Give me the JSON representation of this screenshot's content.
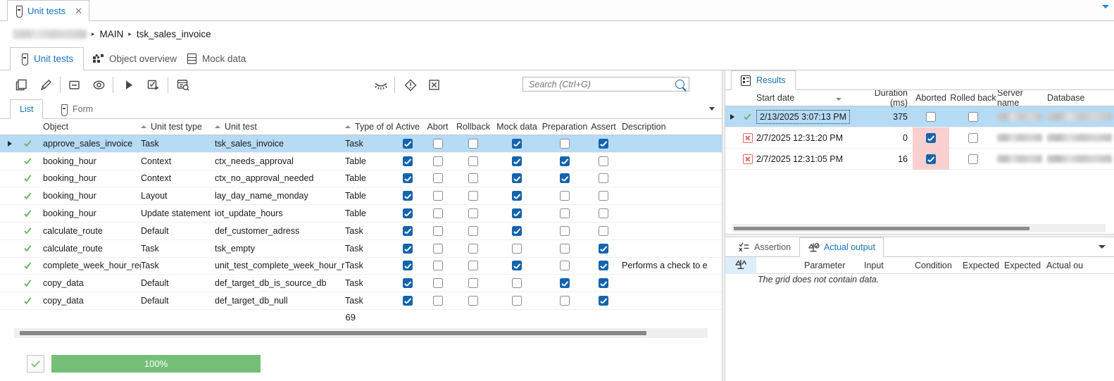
{
  "window": {
    "document_tab": {
      "label": "Unit tests",
      "close": "✕",
      "icon": "test-tube-icon"
    },
    "collapse_chevron": "▾"
  },
  "breadcrumb": {
    "redacted": "",
    "sep": "▸",
    "items": [
      "MAIN",
      "tsk_sales_invoice"
    ]
  },
  "module_tabs": [
    {
      "label": "Unit tests",
      "icon": "test-tube-icon",
      "active": true
    },
    {
      "label": "Object overview",
      "icon": "object-overview-icon",
      "active": false
    },
    {
      "label": "Mock data",
      "icon": "mock-data-icon",
      "active": false
    }
  ],
  "toolbar": {
    "buttons": [
      {
        "name": "copy-button",
        "icon": "copy-icon"
      },
      {
        "name": "edit-button",
        "icon": "pencil-icon"
      },
      {
        "name": "delete-button",
        "icon": "minus-box-icon"
      },
      {
        "name": "view-button",
        "icon": "eye-icon"
      },
      {
        "name": "run-button",
        "icon": "play-icon"
      },
      {
        "name": "run-selected-button",
        "icon": "run-checked-icon"
      },
      {
        "name": "inspect-button",
        "icon": "inspect-grid-icon"
      },
      {
        "name": "hide-button",
        "icon": "eye-closed-icon"
      },
      {
        "name": "warnings-button",
        "icon": "warning-diamond-icon"
      },
      {
        "name": "stop-button",
        "icon": "cancel-box-icon"
      }
    ],
    "search": {
      "placeholder": "Search (Ctrl+G)",
      "value": "",
      "icon": "search-icon"
    }
  },
  "view_tabs": [
    {
      "label": "List",
      "active": true
    },
    {
      "label": "Form",
      "icon": "test-tube-icon",
      "active": false
    }
  ],
  "grid": {
    "columns": [
      {
        "key": "object",
        "label": "Object",
        "sorted": true
      },
      {
        "key": "unit_test_type",
        "label": "Unit test type",
        "sorted": true
      },
      {
        "key": "unit_test",
        "label": "Unit test",
        "sorted": true
      },
      {
        "key": "type_of_object",
        "label": "Type of object",
        "sorted": true
      },
      {
        "key": "active",
        "label": "Active"
      },
      {
        "key": "abort",
        "label": "Abort"
      },
      {
        "key": "rollback",
        "label": "Rollback"
      },
      {
        "key": "mock_data",
        "label": "Mock data"
      },
      {
        "key": "preparation",
        "label": "Preparation"
      },
      {
        "key": "assert",
        "label": "Assert"
      },
      {
        "key": "description",
        "label": "Description"
      }
    ],
    "rows": [
      {
        "status": "pass",
        "object": "approve_sales_invoice",
        "unit_test_type": "Task",
        "unit_test": "tsk_sales_invoice",
        "type_of_object": "Task",
        "active": true,
        "abort": false,
        "rollback": false,
        "mock_data": true,
        "preparation": false,
        "assert": true,
        "description": "",
        "selected": true,
        "expandable": true
      },
      {
        "status": "pass",
        "object": "booking_hour",
        "unit_test_type": "Context",
        "unit_test": "ctx_needs_approval",
        "type_of_object": "Table",
        "active": true,
        "abort": false,
        "rollback": false,
        "mock_data": true,
        "preparation": true,
        "assert": false,
        "description": ""
      },
      {
        "status": "pass",
        "object": "booking_hour",
        "unit_test_type": "Context",
        "unit_test": "ctx_no_approval_needed",
        "type_of_object": "Table",
        "active": true,
        "abort": false,
        "rollback": false,
        "mock_data": true,
        "preparation": true,
        "assert": false,
        "description": ""
      },
      {
        "status": "pass",
        "object": "booking_hour",
        "unit_test_type": "Layout",
        "unit_test": "lay_day_name_monday",
        "type_of_object": "Table",
        "active": true,
        "abort": false,
        "rollback": false,
        "mock_data": true,
        "preparation": false,
        "assert": false,
        "description": ""
      },
      {
        "status": "pass",
        "object": "booking_hour",
        "unit_test_type": "Update statement",
        "unit_test": "iot_update_hours",
        "type_of_object": "Table",
        "active": true,
        "abort": false,
        "rollback": false,
        "mock_data": true,
        "preparation": false,
        "assert": false,
        "description": ""
      },
      {
        "status": "pass",
        "object": "calculate_route",
        "unit_test_type": "Default",
        "unit_test": "def_customer_adress",
        "type_of_object": "Task",
        "active": true,
        "abort": false,
        "rollback": false,
        "mock_data": true,
        "preparation": false,
        "assert": false,
        "description": ""
      },
      {
        "status": "pass",
        "object": "calculate_route",
        "unit_test_type": "Task",
        "unit_test": "tsk_empty",
        "type_of_object": "Task",
        "active": true,
        "abort": false,
        "rollback": false,
        "mock_data": false,
        "preparation": false,
        "assert": true,
        "description": ""
      },
      {
        "status": "pass",
        "object": "complete_week_hour_reg",
        "unit_test_type": "Task",
        "unit_test": "unit_test_complete_week_hour_r",
        "type_of_object": "Task",
        "active": true,
        "abort": false,
        "rollback": false,
        "mock_data": true,
        "preparation": false,
        "assert": true,
        "description": "Performs a check to e"
      },
      {
        "status": "pass",
        "object": "copy_data",
        "unit_test_type": "Default",
        "unit_test": "def_target_db_is_source_db",
        "type_of_object": "Task",
        "active": true,
        "abort": false,
        "rollback": false,
        "mock_data": false,
        "preparation": true,
        "assert": true,
        "description": ""
      },
      {
        "status": "pass",
        "object": "copy_data",
        "unit_test_type": "Default",
        "unit_test": "def_target_db_null",
        "type_of_object": "Task",
        "active": true,
        "abort": false,
        "rollback": false,
        "mock_data": false,
        "preparation": false,
        "assert": true,
        "description": ""
      }
    ],
    "record_count": "69"
  },
  "progress": {
    "percent_label": "100%",
    "percent": 100,
    "color": "#75bf79",
    "status_icon": "check-icon"
  },
  "results": {
    "tab": {
      "label": "Results",
      "icon": "results-clipboard-icon"
    },
    "columns": [
      {
        "key": "start_date",
        "label": "Start date",
        "sorted_desc": true
      },
      {
        "key": "duration",
        "label": "Duration (ms)"
      },
      {
        "key": "aborted",
        "label": "Aborted"
      },
      {
        "key": "rolled_back",
        "label": "Rolled back"
      },
      {
        "key": "server_name",
        "label": "Server name"
      },
      {
        "key": "database",
        "label": "Database"
      }
    ],
    "rows": [
      {
        "status": "pass",
        "start_date": "2/13/2025 3:07:13 PM",
        "duration": "375",
        "aborted": false,
        "rolled_back": false,
        "server_name": "",
        "database": "",
        "selected": true,
        "expandable": true
      },
      {
        "status": "fail",
        "start_date": "2/7/2025 12:31:20 PM",
        "duration": "0",
        "aborted": true,
        "rolled_back": false,
        "server_name": "",
        "database": ""
      },
      {
        "status": "fail",
        "start_date": "2/7/2025 12:31:05 PM",
        "duration": "16",
        "aborted": true,
        "rolled_back": false,
        "server_name": "",
        "database": ""
      }
    ]
  },
  "detail": {
    "tabs": [
      {
        "label": "Assertion",
        "icon": "assertion-icon",
        "active": false
      },
      {
        "label": "Actual output",
        "icon": "scale-icon",
        "active": true
      }
    ],
    "columns": [
      "Parameter",
      "Input",
      "Condition",
      "Expected",
      "Expected",
      "Actual ou"
    ],
    "empty_message": "The grid does not contain data.",
    "row_icon": "scale-icon"
  },
  "colors": {
    "accent": "#1673c2",
    "selection": "#b5dbf5",
    "checkbox_on": "#1464ad",
    "pass": "#6cb56c",
    "fail": "#e06767",
    "aborted_cell": "#f9cfcf",
    "progress": "#75bf79"
  }
}
